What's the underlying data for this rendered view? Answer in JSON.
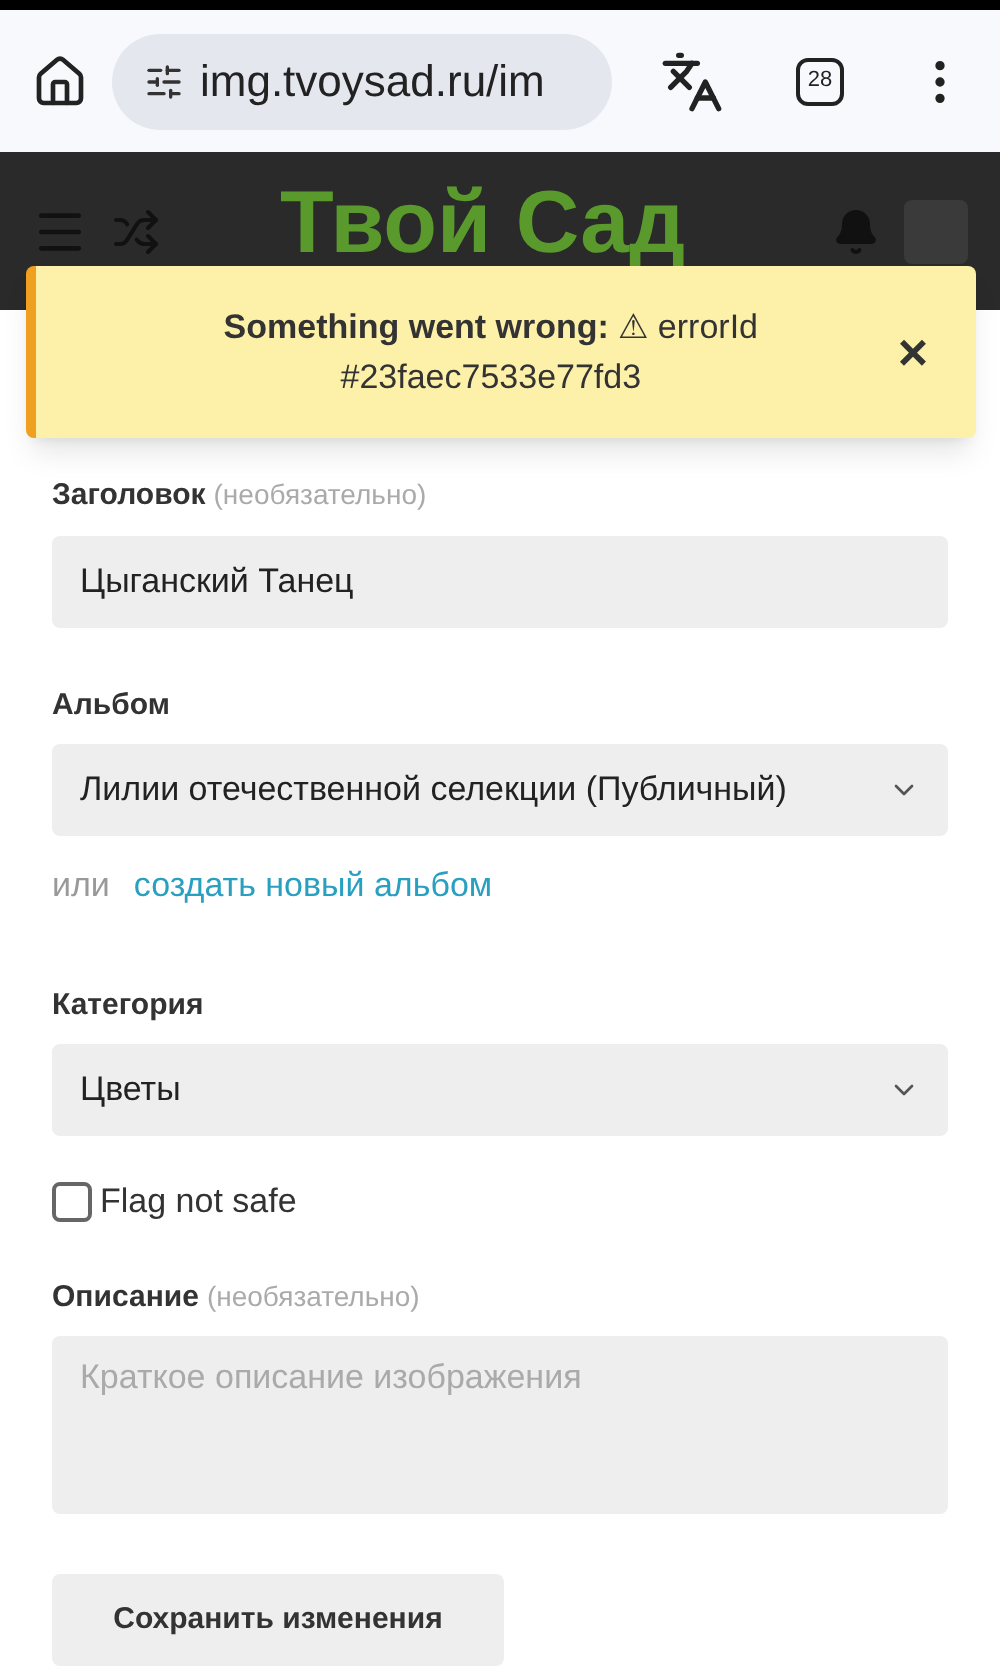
{
  "browser": {
    "url": "img.tvoysad.ru/im",
    "tab_count": "28"
  },
  "header": {
    "logo": "Твой Сад"
  },
  "toast": {
    "title": "Something went wrong:",
    "warning": "⚠",
    "message": "errorId #23faec7533e77fd3",
    "close": "×"
  },
  "form": {
    "title_field": {
      "label": "Заголовок",
      "hint": "(необязательно)",
      "value": "Цыганский Танец"
    },
    "album": {
      "label": "Альбом",
      "value": "Лилии отечественной селекции (Публичный)"
    },
    "album_alt": {
      "prefix": "или",
      "link": "создать новый альбом"
    },
    "category": {
      "label": "Категория",
      "value": "Цветы"
    },
    "nsfw": {
      "label": "Flag not safe",
      "checked": false
    },
    "description": {
      "label": "Описание",
      "hint": "(необязательно)",
      "placeholder": "Краткое описание изображения"
    },
    "submit": "Сохранить изменения"
  }
}
